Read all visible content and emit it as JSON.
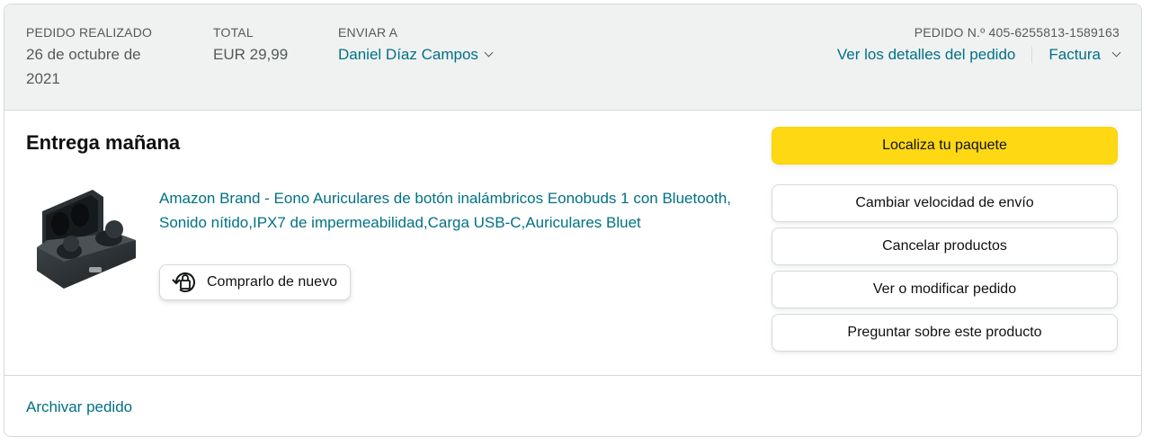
{
  "header": {
    "placed": {
      "label": "PEDIDO REALIZADO",
      "value": "26 de octubre de 2021"
    },
    "total": {
      "label": "TOTAL",
      "value": "EUR 29,99"
    },
    "ship_to": {
      "label": "ENVIAR A",
      "name": "Daniel Díaz Campos"
    },
    "order_number": "PEDIDO N.º 405-6255813-1589163",
    "details_link": "Ver los detalles del pedido",
    "invoice_link": "Factura"
  },
  "delivery": {
    "status": "Entrega mañana"
  },
  "product": {
    "title": "Amazon Brand - Eono Auriculares de botón inalámbricos Eonobuds 1 con Bluetooth, Sonido nítido,IPX7 de impermeabilidad,Carga USB-C,Auriculares Bluet",
    "buy_again": "Comprarlo de nuevo"
  },
  "actions": {
    "track": "Localiza tu paquete",
    "change_speed": "Cambiar velocidad de envío",
    "cancel": "Cancelar productos",
    "view_modify": "Ver o modificar pedido",
    "ask": "Preguntar sobre este producto"
  },
  "footer": {
    "archive": "Archivar pedido"
  },
  "colors": {
    "link": "#007185",
    "primary_button": "#ffd814",
    "header_bg": "#f0f2f2"
  },
  "icons": [
    "chevron-down-icon",
    "buy-again-icon",
    "earbuds-product-image"
  ]
}
